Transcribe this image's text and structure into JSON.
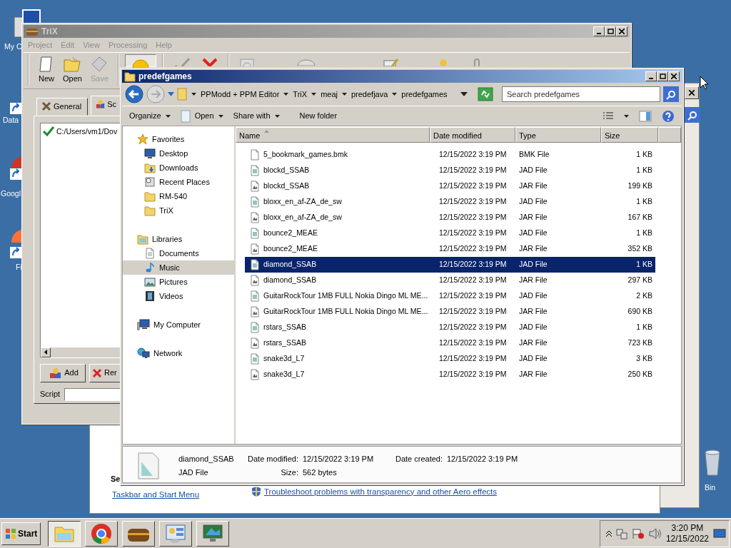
{
  "desktop_icons": [
    {
      "label": "My C",
      "kind": "computer"
    },
    {
      "label": "Data",
      "kind": "shortcut"
    },
    {
      "label": "Googl",
      "kind": "chrome"
    },
    {
      "label": "Fi",
      "kind": "firefox"
    },
    {
      "label": "Bin",
      "kind": "recycle"
    }
  ],
  "back_window": {
    "heading": "Se",
    "links": [
      "Taskbar and Start Menu",
      "Troubleshoot problems with transparency and other Aero effects"
    ]
  },
  "trix": {
    "title": "TriX",
    "menu": [
      "Project",
      "Edit",
      "View",
      "Processing",
      "Help"
    ],
    "toolbar": [
      {
        "label": "New",
        "kind": "new",
        "disabled": false
      },
      {
        "label": "Open",
        "kind": "open",
        "disabled": false
      },
      {
        "label": "Save",
        "kind": "save",
        "disabled": true
      }
    ],
    "tabs": [
      {
        "label": "General",
        "selected": false
      },
      {
        "label": "Sc",
        "selected": true
      }
    ],
    "list_item": "C:/Users/vm1/Dov",
    "buttons": [
      {
        "label": "Add",
        "kind": "add"
      },
      {
        "label": "Rer",
        "kind": "remove"
      }
    ],
    "script_label": "Script"
  },
  "explorer": {
    "title": "predefgames",
    "breadcrumb": [
      "PPModd + PPM Editor",
      "TriX",
      "meaj",
      "predefjava",
      "predefgames"
    ],
    "search": {
      "placeholder": "Search predefgames"
    },
    "commands": [
      {
        "label": "Organize",
        "dropdown": true,
        "kind": "text"
      },
      {
        "label": "Open",
        "dropdown": true,
        "kind": "open"
      },
      {
        "label": "Share with",
        "dropdown": true,
        "kind": "text"
      },
      {
        "label": "New folder",
        "dropdown": false,
        "kind": "text"
      }
    ],
    "nav": [
      {
        "label": "Favorites",
        "kind": "star",
        "selected": false,
        "children": [
          {
            "label": "Desktop",
            "kind": "desktop",
            "selected": false
          },
          {
            "label": "Downloads",
            "kind": "downloads",
            "selected": false
          },
          {
            "label": "Recent Places",
            "kind": "recent",
            "selected": false
          },
          {
            "label": "RM-540",
            "kind": "folder",
            "selected": false
          },
          {
            "label": "TriX",
            "kind": "folder",
            "selected": false
          }
        ]
      },
      {
        "label": "Libraries",
        "kind": "libraries",
        "selected": false,
        "children": [
          {
            "label": "Documents",
            "kind": "documents",
            "selected": false
          },
          {
            "label": "Music",
            "kind": "music",
            "selected": true
          },
          {
            "label": "Pictures",
            "kind": "pictures",
            "selected": false
          },
          {
            "label": "Videos",
            "kind": "videos",
            "selected": false
          }
        ]
      },
      {
        "label": "My Computer",
        "kind": "computer",
        "selected": false
      },
      {
        "label": "Network",
        "kind": "network",
        "selected": false
      }
    ],
    "columns": [
      {
        "label": "Name",
        "sorted": true
      },
      {
        "label": "Date modified",
        "sorted": false
      },
      {
        "label": "Type",
        "sorted": false
      },
      {
        "label": "Size",
        "sorted": false
      }
    ],
    "rows": [
      {
        "name": "5_bookmark_games.bmk",
        "date": "12/15/2022 3:19 PM",
        "type": "BMK File",
        "size": "1 KB",
        "kind": "bmk",
        "selected": false
      },
      {
        "name": "blockd_SSAB",
        "date": "12/15/2022 3:19 PM",
        "type": "JAD File",
        "size": "1 KB",
        "kind": "jad",
        "selected": false
      },
      {
        "name": "blockd_SSAB",
        "date": "12/15/2022 3:19 PM",
        "type": "JAR File",
        "size": "199 KB",
        "kind": "jar",
        "selected": false
      },
      {
        "name": "bloxx_en_af-ZA_de_sw",
        "date": "12/15/2022 3:19 PM",
        "type": "JAD File",
        "size": "1 KB",
        "kind": "jad",
        "selected": false
      },
      {
        "name": "bloxx_en_af-ZA_de_sw",
        "date": "12/15/2022 3:19 PM",
        "type": "JAR File",
        "size": "167 KB",
        "kind": "jar",
        "selected": false
      },
      {
        "name": "bounce2_MEAE",
        "date": "12/15/2022 3:19 PM",
        "type": "JAD File",
        "size": "1 KB",
        "kind": "jad",
        "selected": false
      },
      {
        "name": "bounce2_MEAE",
        "date": "12/15/2022 3:19 PM",
        "type": "JAR File",
        "size": "352 KB",
        "kind": "jar",
        "selected": false
      },
      {
        "name": "diamond_SSAB",
        "date": "12/15/2022 3:19 PM",
        "type": "JAD File",
        "size": "1 KB",
        "kind": "jad",
        "selected": true
      },
      {
        "name": "diamond_SSAB",
        "date": "12/15/2022 3:19 PM",
        "type": "JAR File",
        "size": "297 KB",
        "kind": "jar",
        "selected": false
      },
      {
        "name": "GuitarRockTour 1MB FULL Nokia Dingo ML ME...",
        "date": "12/15/2022 3:19 PM",
        "type": "JAD File",
        "size": "2 KB",
        "kind": "jad",
        "selected": false
      },
      {
        "name": "GuitarRockTour 1MB FULL Nokia Dingo ML ME...",
        "date": "12/15/2022 3:19 PM",
        "type": "JAR File",
        "size": "690 KB",
        "kind": "jar",
        "selected": false
      },
      {
        "name": "rstars_SSAB",
        "date": "12/15/2022 3:19 PM",
        "type": "JAD File",
        "size": "1 KB",
        "kind": "jad",
        "selected": false
      },
      {
        "name": "rstars_SSAB",
        "date": "12/15/2022 3:19 PM",
        "type": "JAR File",
        "size": "723 KB",
        "kind": "jar",
        "selected": false
      },
      {
        "name": "snake3d_L7",
        "date": "12/15/2022 3:19 PM",
        "type": "JAD File",
        "size": "3 KB",
        "kind": "jad",
        "selected": false
      },
      {
        "name": "snake3d_L7",
        "date": "12/15/2022 3:19 PM",
        "type": "JAR File",
        "size": "250 KB",
        "kind": "jar",
        "selected": false
      }
    ],
    "details": {
      "name": "diamond_SSAB",
      "type": "JAD File",
      "date_modified_label": "Date modified:",
      "date_modified": "12/15/2022 3:19 PM",
      "date_created_label": "Date created:",
      "date_created": "12/15/2022 3:19 PM",
      "size_label": "Size:",
      "size": "562 bytes"
    }
  },
  "taskbar": {
    "start": "Start",
    "apps": [
      {
        "kind": "explorer",
        "selected": true
      },
      {
        "kind": "chrome",
        "selected": false
      },
      {
        "kind": "trix",
        "selected": false
      },
      {
        "kind": "control",
        "selected": false
      },
      {
        "kind": "monitor",
        "selected": false
      }
    ],
    "time": "3:20 PM",
    "date": "12/15/2022"
  }
}
